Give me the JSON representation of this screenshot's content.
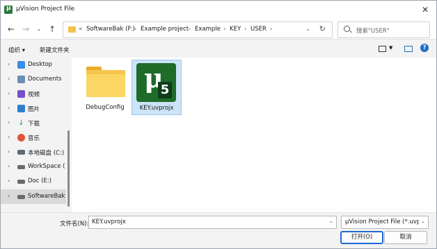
{
  "window": {
    "title": "µVision Project File"
  },
  "nav": {
    "breadcrumb": [
      "«",
      "SoftwareBak (F:)",
      "Example project",
      "Example",
      "KEY",
      "USER"
    ],
    "search_placeholder": "搜索\"USER\""
  },
  "toolbar": {
    "organize": "组织 ▾",
    "new_folder": "新建文件夹"
  },
  "sidebar": {
    "items": [
      {
        "label": "Desktop",
        "icon": "desktop-icon",
        "color": "#3a8ee6"
      },
      {
        "label": "Documents",
        "icon": "documents-icon",
        "color": "#6a8fb8"
      },
      {
        "label": "视频",
        "icon": "videos-icon",
        "color": "#7a4fc9"
      },
      {
        "label": "图片",
        "icon": "pictures-icon",
        "color": "#2f7fd0"
      },
      {
        "label": "下载",
        "icon": "downloads-icon",
        "color": "#1f9a6a"
      },
      {
        "label": "音乐",
        "icon": "music-icon",
        "color": "#e0533a"
      },
      {
        "label": "本地磁盘 (C:)",
        "icon": "windows-drive-icon",
        "color": "#5f6b78"
      },
      {
        "label": "WorkSpace (D",
        "icon": "drive-icon",
        "color": "#6b6b6b"
      },
      {
        "label": "Doc (E:)",
        "icon": "drive-icon",
        "color": "#6b6b6b"
      },
      {
        "label": "SoftwareBak (",
        "icon": "drive-icon",
        "color": "#6b6b6b"
      }
    ]
  },
  "files": [
    {
      "name": "DebugConfig",
      "type": "folder"
    },
    {
      "name": "KEY.uvprojx",
      "type": "uvision-project",
      "badge": "5"
    }
  ],
  "bottom": {
    "filename_label": "文件名(N):",
    "filename_value": "KEY.uvprojx",
    "filetype_value": "µVision Project File (*.uvproj",
    "open_label": "打开(O)",
    "cancel_label": "取消"
  }
}
